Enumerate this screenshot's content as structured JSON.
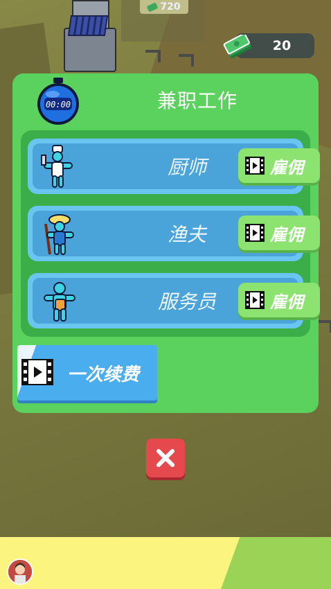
{
  "hud": {
    "money": "20",
    "world_price": "720"
  },
  "panel": {
    "title": "兼职工作",
    "stopwatch_time": "00:00",
    "jobs": [
      {
        "name": "厨师",
        "hire_label": "雇佣",
        "icon": "chef-icon"
      },
      {
        "name": "渔夫",
        "hire_label": "雇佣",
        "icon": "fisherman-icon"
      },
      {
        "name": "服务员",
        "hire_label": "雇佣",
        "icon": "waiter-icon"
      }
    ],
    "renew_label": "一次续费"
  },
  "colors": {
    "panel": "#5bd15e",
    "job_card": "#4aa3d9",
    "hire_button": "#8de370",
    "renew_button": "#4aaeee",
    "close_button": "#e5484d"
  }
}
